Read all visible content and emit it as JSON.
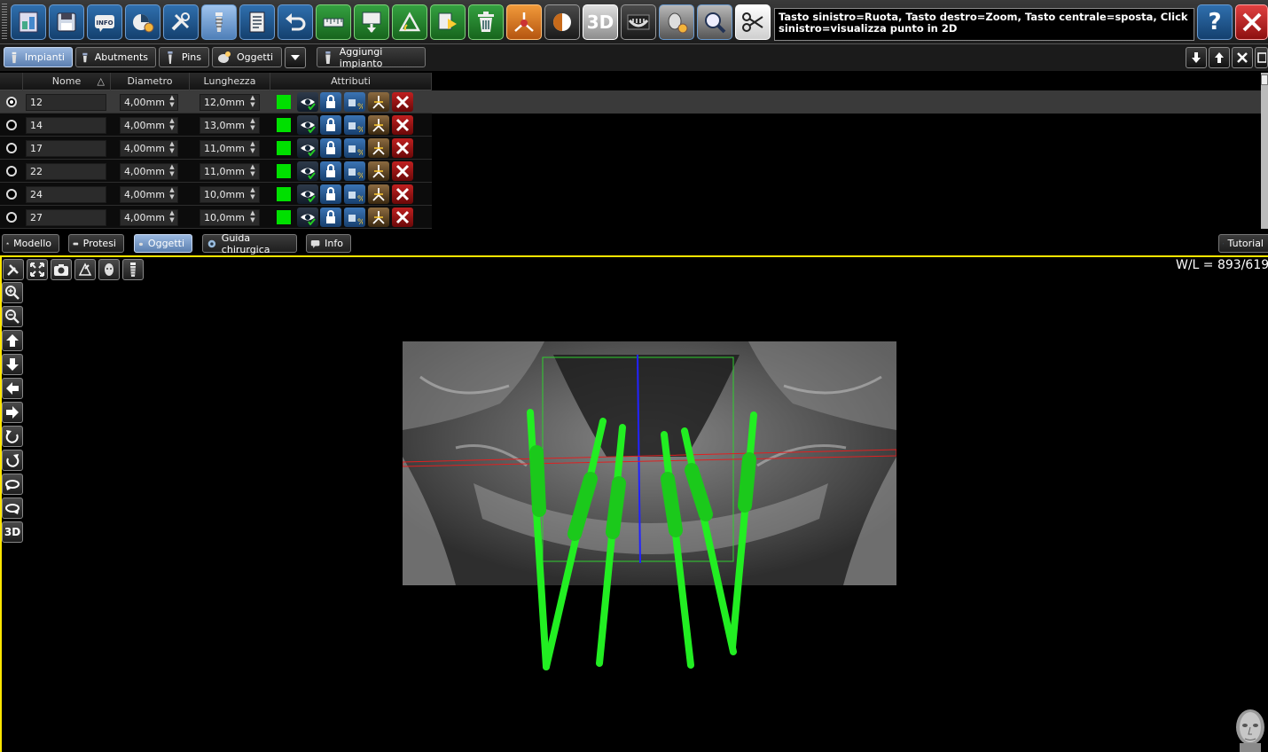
{
  "toolbar": {
    "status_text": "Tasto sinistro=Ruota, Tasto destro=Zoom, Tasto centrale=sposta, Click sinistro=visualizza punto in 2D",
    "info_label": "INFO",
    "mode_3d_label": "3D",
    "help_label": "?"
  },
  "tabs": {
    "impianti": "Impianti",
    "abutments": "Abutments",
    "pins": "Pins",
    "oggetti": "Oggetti",
    "aggiungi": "Aggiungi impianto"
  },
  "table": {
    "headers": {
      "nome": "Nome",
      "diametro": "Diametro",
      "lunghezza": "Lunghezza",
      "attributi": "Attributi"
    },
    "rows": [
      {
        "nome": "12",
        "diametro": "4,00mm",
        "lunghezza": "12,0mm"
      },
      {
        "nome": "14",
        "diametro": "4,00mm",
        "lunghezza": "13,0mm"
      },
      {
        "nome": "17",
        "diametro": "4,00mm",
        "lunghezza": "11,0mm"
      },
      {
        "nome": "22",
        "diametro": "4,00mm",
        "lunghezza": "11,0mm"
      },
      {
        "nome": "24",
        "diametro": "4,00mm",
        "lunghezza": "10,0mm"
      },
      {
        "nome": "27",
        "diametro": "4,00mm",
        "lunghezza": "10,0mm"
      }
    ],
    "implant_color": "#00e000"
  },
  "bottom_tabs": {
    "modello": "Modello",
    "protesi": "Protesi",
    "oggetti": "Oggetti",
    "guida": "Guida chirurgica",
    "info": "Info",
    "tutorial": "Tutorial"
  },
  "viewport": {
    "wl_text": "W/L = 893/619",
    "mode_label": "3D",
    "accent": "#ffe600"
  }
}
